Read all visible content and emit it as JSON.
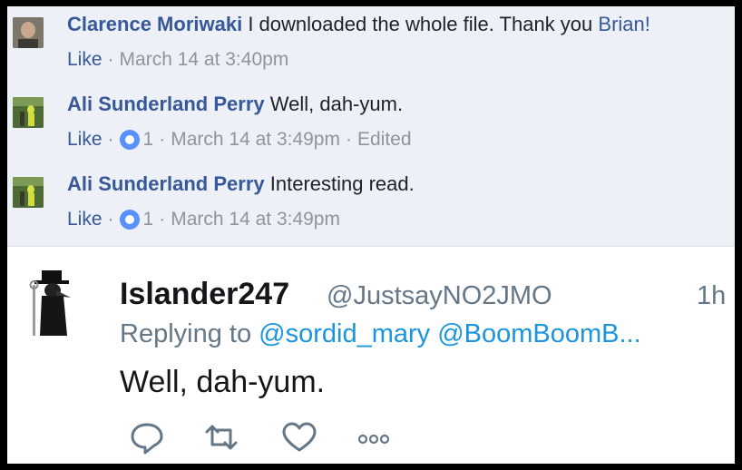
{
  "facebook": {
    "comments": [
      {
        "avatar_icon": "user-photo-icon",
        "name": "Clarence Moriwaki",
        "text": "I downloaded the whole file. Thank you",
        "mention": "Brian!",
        "like_label": "Like",
        "timestamp": "March 14 at 3:40pm"
      },
      {
        "avatar_icon": "user-photo-icon",
        "name": "Ali Sunderland Perry",
        "text": "Well, dah-yum.",
        "like_label": "Like",
        "reaction_count": "1",
        "timestamp": "March 14 at 3:49pm",
        "edited_label": "Edited"
      },
      {
        "avatar_icon": "user-photo-icon",
        "name": "Ali Sunderland Perry",
        "text": "Interesting read.",
        "like_label": "Like",
        "reaction_count": "1",
        "timestamp": "March 14 at 3:49pm"
      }
    ],
    "colors": {
      "name": "#365899",
      "meta": "#90949c",
      "background": "#edf0f6",
      "like_badge": "#5890ff"
    }
  },
  "tweet": {
    "display_name": "Islander247",
    "handle": "@JustsayNO2JMO",
    "time": "1h",
    "replying_prefix": "Replying to",
    "replying_mentions": "@sordid_mary @BoomBoomB...",
    "body": "Well, dah-yum.",
    "actions": [
      "reply-icon",
      "retweet-icon",
      "heart-icon",
      "more-icon"
    ],
    "colors": {
      "mention": "#1b95e0",
      "secondary": "#657786",
      "text": "#14171a"
    }
  },
  "separator": "·"
}
